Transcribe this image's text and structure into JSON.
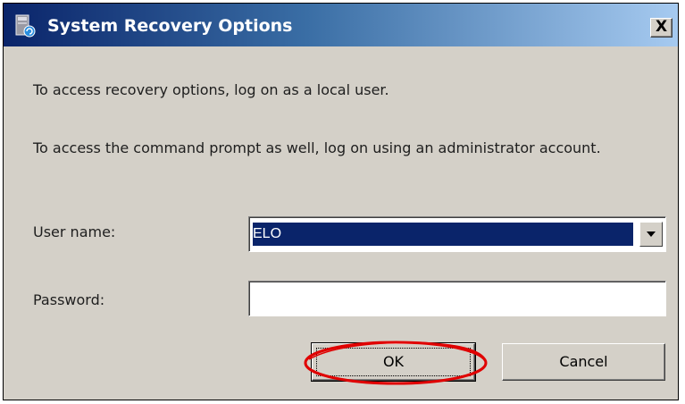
{
  "window": {
    "title": "System Recovery Options",
    "close_label": "X"
  },
  "content": {
    "message_local": "To access recovery options, log on as a local user.",
    "message_admin": "To access the command prompt as well, log on using an administrator account."
  },
  "form": {
    "username_label": "User name:",
    "username_value": "ELO",
    "password_label": "Password:",
    "password_value": ""
  },
  "buttons": {
    "ok_label": "OK",
    "cancel_label": "Cancel"
  },
  "colors": {
    "titlebar_start": "#0a246a",
    "titlebar_end": "#a6caf0",
    "dialog_bg": "#d4d0c8",
    "selection_bg": "#0a246a",
    "annotation": "#e00000"
  },
  "icons": {
    "title": "system-recovery-icon",
    "dropdown": "chevron-down-icon"
  }
}
